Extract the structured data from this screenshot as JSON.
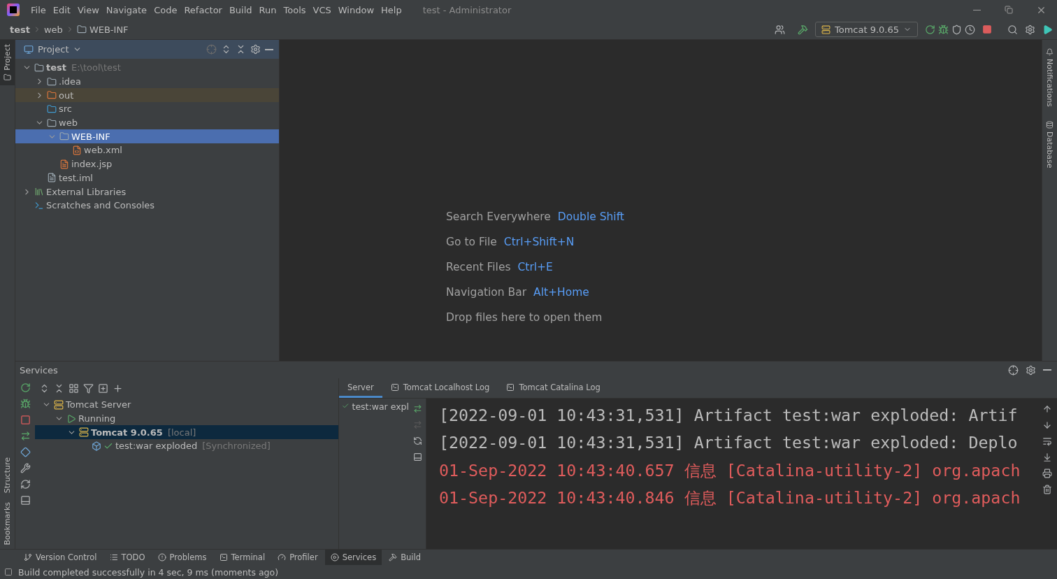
{
  "menu": [
    "File",
    "Edit",
    "View",
    "Navigate",
    "Code",
    "Refactor",
    "Build",
    "Run",
    "Tools",
    "VCS",
    "Window",
    "Help"
  ],
  "window_title": "test - Administrator",
  "breadcrumbs": [
    {
      "label": "test",
      "kind": "project"
    },
    {
      "label": "web",
      "kind": "plain"
    },
    {
      "label": "WEB-INF",
      "kind": "folder"
    }
  ],
  "run_config": "Tomcat 9.0.65",
  "left_stripe_top": [
    {
      "label": "Project",
      "selected": true
    }
  ],
  "left_stripe_bottom": [
    {
      "label": "Structure",
      "selected": false
    },
    {
      "label": "Bookmarks",
      "selected": false
    }
  ],
  "right_stripe": [
    {
      "label": "Notifications",
      "kind": "bell"
    },
    {
      "label": "Database",
      "kind": "database"
    }
  ],
  "project_panel": {
    "title": "Project",
    "tree": [
      {
        "name": "test",
        "hint": "E:\\tool\\test",
        "kind": "module",
        "expanded": true,
        "selected": false,
        "children": [
          {
            "name": ".idea",
            "kind": "folder",
            "expanded": false,
            "selected": false
          },
          {
            "name": "out",
            "kind": "folder-excluded",
            "expanded": false,
            "selected": false
          },
          {
            "name": "src",
            "kind": "folder-source",
            "selected": false
          },
          {
            "name": "web",
            "kind": "folder-web",
            "expanded": true,
            "selected": false,
            "children": [
              {
                "name": "WEB-INF",
                "kind": "folder",
                "expanded": true,
                "selected": true,
                "children": [
                  {
                    "name": "web.xml",
                    "kind": "xml",
                    "selected": false
                  }
                ]
              },
              {
                "name": "index.jsp",
                "kind": "jsp",
                "selected": false
              }
            ]
          },
          {
            "name": "test.iml",
            "kind": "iml",
            "selected": false
          }
        ]
      },
      {
        "name": "External Libraries",
        "kind": "libraries",
        "expanded": false,
        "selected": false
      },
      {
        "name": "Scratches and Consoles",
        "kind": "scratches",
        "selected": false
      }
    ]
  },
  "editor_hints": [
    {
      "label": "Search Everywhere",
      "shortcut": "Double Shift"
    },
    {
      "label": "Go to File",
      "shortcut": "Ctrl+Shift+N"
    },
    {
      "label": "Recent Files",
      "shortcut": "Ctrl+E"
    },
    {
      "label": "Navigation Bar",
      "shortcut": "Alt+Home"
    },
    {
      "label": "Drop files here to open them"
    }
  ],
  "services": {
    "title": "Services",
    "tree": [
      {
        "name": "Tomcat Server",
        "kind": "server",
        "expanded": true,
        "selected": false,
        "children": [
          {
            "name": "Running",
            "kind": "running",
            "expanded": true,
            "selected": false,
            "children": [
              {
                "name": "Tomcat 9.0.65",
                "suffix": "[local]",
                "kind": "tomcat",
                "expanded": true,
                "selected": true,
                "children": [
                  {
                    "name": "test:war exploded",
                    "suffix": "[Synchronized]",
                    "kind": "artifact",
                    "selected": false
                  }
                ]
              }
            ]
          }
        ]
      }
    ],
    "tabs": [
      {
        "label": "Server",
        "selected": true
      },
      {
        "label": "Tomcat Localhost Log",
        "selected": false
      },
      {
        "label": "Tomcat Catalina Log",
        "selected": false
      }
    ],
    "deployment": "test:war expl",
    "log": [
      {
        "text": "[2022-09-01 10:43:31,531] Artifact test:war exploded: Artif",
        "kind": "stdout"
      },
      {
        "text": "[2022-09-01 10:43:31,531] Artifact test:war exploded: Deplo",
        "kind": "stdout"
      },
      {
        "text": "01-Sep-2022 10:43:40.657 信息 [Catalina-utility-2] org.apach",
        "kind": "stderr"
      },
      {
        "text": "01-Sep-2022 10:43:40.846 信息 [Catalina-utility-2] org.apach",
        "kind": "stderr"
      }
    ]
  },
  "tool_windows": [
    {
      "label": "Version Control",
      "kind": "vcs",
      "selected": false
    },
    {
      "label": "TODO",
      "kind": "todo",
      "selected": false
    },
    {
      "label": "Problems",
      "kind": "problems",
      "selected": false
    },
    {
      "label": "Terminal",
      "kind": "terminal",
      "selected": false
    },
    {
      "label": "Profiler",
      "kind": "profiler",
      "selected": false
    },
    {
      "label": "Services",
      "kind": "services",
      "selected": true
    },
    {
      "label": "Build",
      "kind": "build",
      "selected": false
    }
  ],
  "status": "Build completed successfully in 4 sec, 9 ms (moments ago)"
}
